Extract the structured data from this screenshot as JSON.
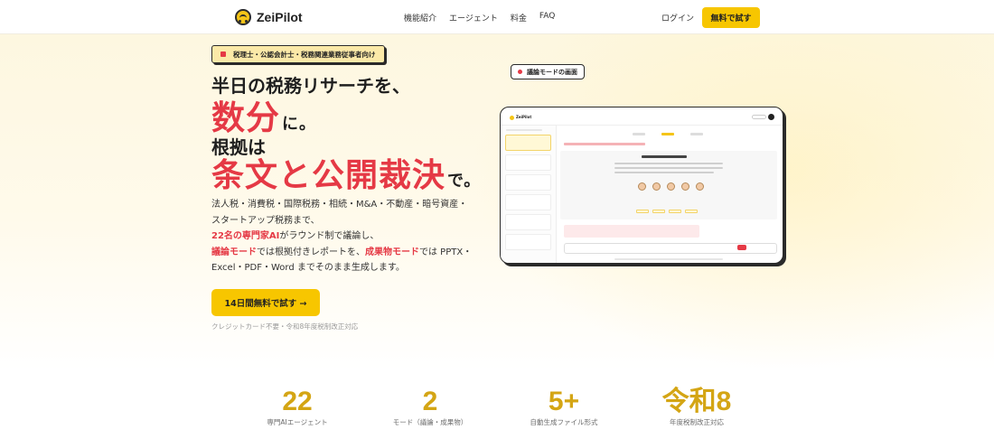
{
  "header": {
    "logo_text": "ZeiPilot",
    "nav": [
      "機能紹介",
      "エージェント",
      "料金",
      "FAQ"
    ],
    "login_label": "ログイン",
    "cta_label": "無料で試す"
  },
  "hero": {
    "badge": "税理士・公認会計士・税務関連業務従事者向け",
    "headline_1": "半日の税務リサーチを、",
    "headline_2_main": "数分",
    "headline_2_suffix": "に。",
    "headline_3": "根拠は",
    "headline_4_main": "条文と公開裁決",
    "headline_4_suffix": "で。",
    "description": {
      "line1": "法人税・消費税・国際税務・相続・M&A・不動産・暗号資産・",
      "line2": "スタートアップ税務まで、",
      "line3_highlight": "22名の専門家AI",
      "line3_rest": "がラウンド制で議論し、",
      "line4_highlight1": "議論モード",
      "line4_mid": "では根拠付きレポートを、",
      "line4_highlight2": "成果物モード",
      "line4_rest": "では PPTX・",
      "line5": "Excel・PDF・Word までそのまま生成します。"
    },
    "cta_label": "14日間無料で試す →",
    "note": "クレジットカード不要・令和8年度税制改正対応"
  },
  "mock": {
    "tag_label": "議論モードの画面",
    "logo_text": "ZeiPilot"
  },
  "stats": [
    {
      "value": "22",
      "label": "専門AIエージェント"
    },
    {
      "value": "2",
      "label": "モード（議論・成果物）"
    },
    {
      "value": "5+",
      "label": "自動生成ファイル形式"
    },
    {
      "value": "令和8",
      "label": "年度税制改正対応"
    }
  ],
  "colors": {
    "accent_yellow": "#f7c600",
    "accent_red": "#e53945",
    "stat_gold": "#d4a514"
  }
}
